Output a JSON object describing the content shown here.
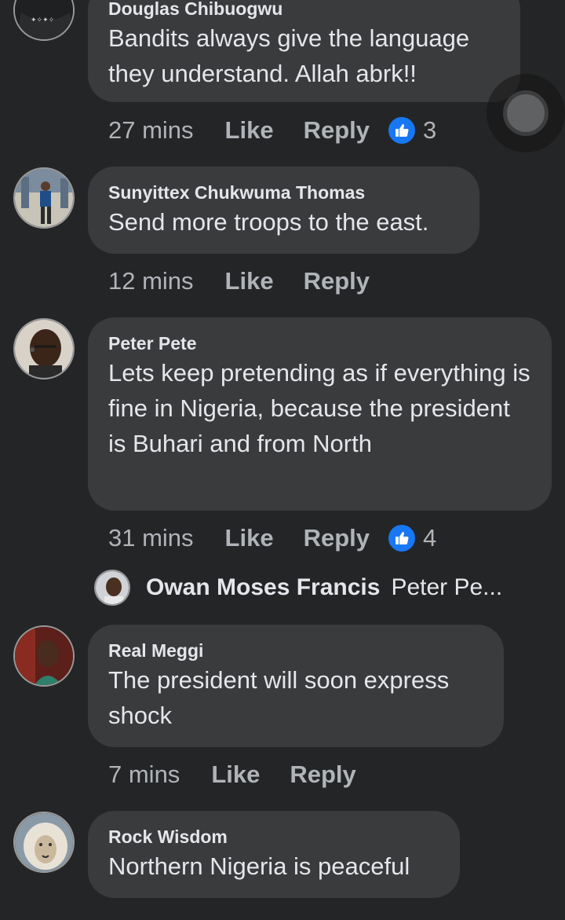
{
  "comments": [
    {
      "author": "Douglas Chibuogwu",
      "text": "Bandits always give the language they understand. Allah abrk!!",
      "time": "27 mins",
      "like_label": "Like",
      "reply_label": "Reply",
      "reaction_count": "3"
    },
    {
      "author": "Sunyittex Chukwuma Thomas",
      "text": "Send more troops to the east.",
      "time": "12 mins",
      "like_label": "Like",
      "reply_label": "Reply"
    },
    {
      "author": "Peter Pete",
      "text": "Lets keep pretending as if everything is fine in Nigeria, because the president is Buhari and from North",
      "time": "31 mins",
      "like_label": "Like",
      "reply_label": "Reply",
      "reaction_count": "4",
      "reply_preview": {
        "author": "Owan Moses Francis",
        "snippet": "Peter Pe..."
      }
    },
    {
      "author": "Real Meggi",
      "text": "The president will soon express shock",
      "time": "7 mins",
      "like_label": "Like",
      "reply_label": "Reply"
    },
    {
      "author": "Rock Wisdom",
      "text": "Northern Nigeria is peaceful"
    }
  ],
  "colors": {
    "background": "#242526",
    "bubble": "#3a3b3c",
    "text": "#e4e6eb",
    "meta": "#b0b3b8",
    "like_blue": "#1877f2"
  },
  "icons": {
    "reaction": "thumbs-up-icon",
    "chat_head": "chat-head-bubble"
  }
}
